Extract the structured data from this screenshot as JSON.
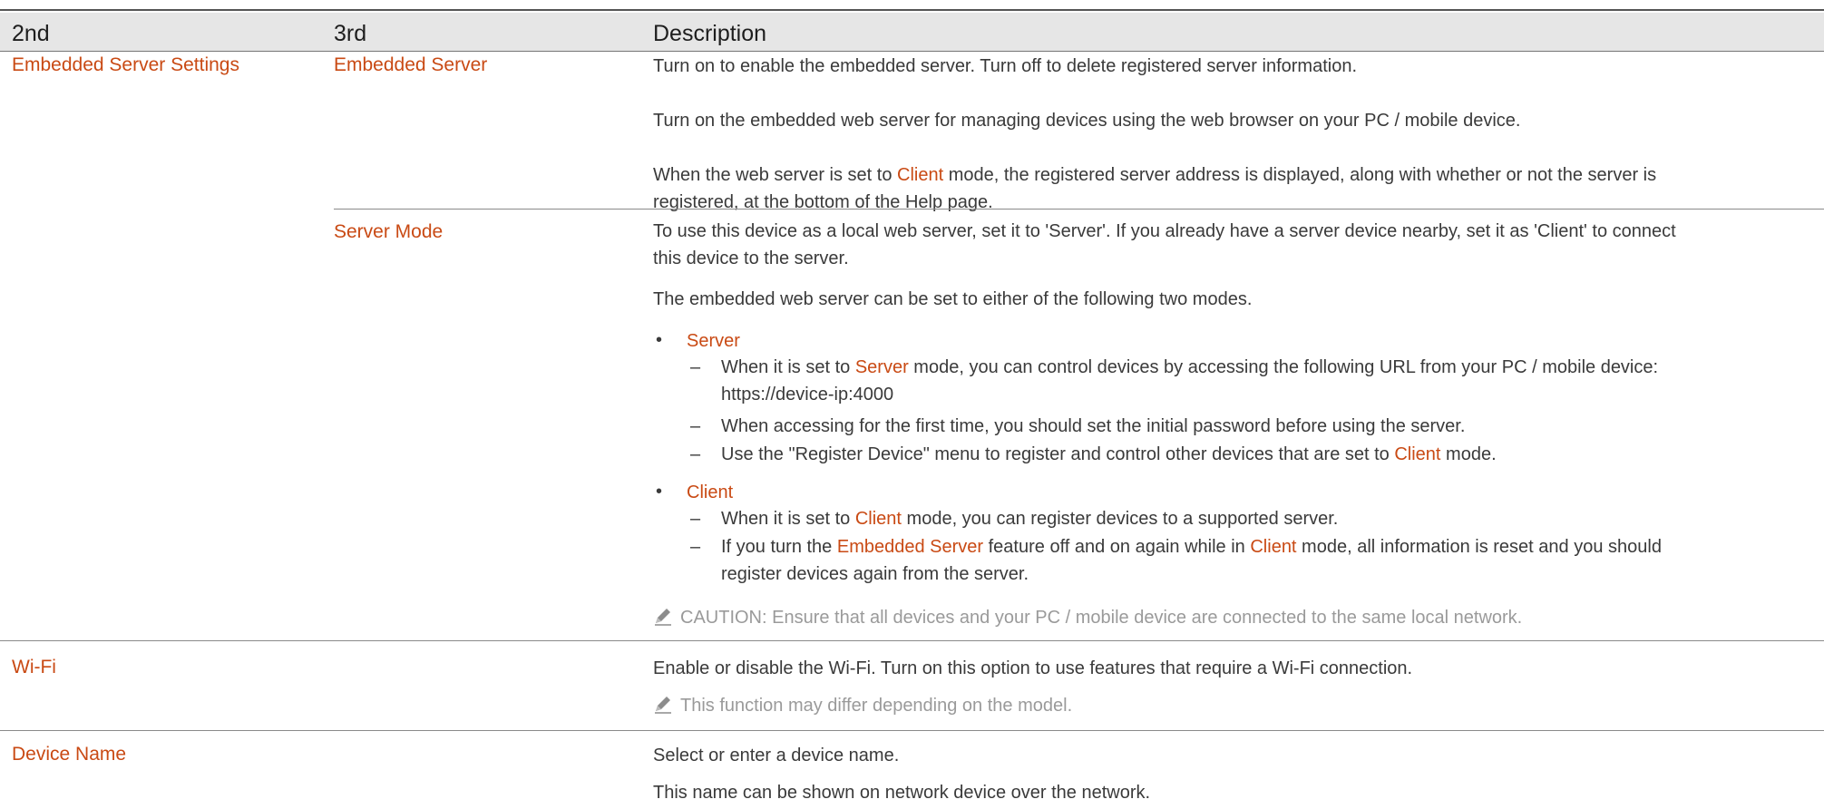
{
  "header": {
    "col_2nd": "2nd",
    "col_3rd": "3rd",
    "col_desc": "Description"
  },
  "rows": {
    "embedded_server_settings": {
      "label": "Embedded Server Settings",
      "embedded_server": {
        "label": "Embedded Server",
        "p1": "Turn on to enable the embedded server. Turn off to delete registered server information.",
        "p2": "Turn on the embedded web server for managing devices using the web browser on your PC / mobile device.",
        "p3_a": "When the web server is set to ",
        "p3_hl": "Client",
        "p3_b": " mode, the registered server address is displayed, along with whether or not the server is",
        "p3_c": "registered, at the bottom of the Help page."
      },
      "server_mode": {
        "label": "Server Mode",
        "p1_a": "To use this device as a local web server, set it to 'Server'. If you already have a server device nearby, set it as 'Client' to connect",
        "p1_b": "this device to the server.",
        "p2": "The embedded web server can be set to either of the following two modes.",
        "bullet_server": "Server",
        "server_d1_a": "When it is set to ",
        "server_d1_hl": "Server",
        "server_d1_b": " mode, you can control devices by accessing the following URL from your PC / mobile device:",
        "server_d1_c": "https://device-ip:4000",
        "server_d2": "When accessing for the first time, you should set the initial password before using the server.",
        "server_d3_a": "Use the \"Register Device\" menu to register and control other devices that are set to ",
        "server_d3_hl": "Client",
        "server_d3_b": " mode.",
        "bullet_client": "Client",
        "client_d1_a": "When it is set to ",
        "client_d1_hl": "Client",
        "client_d1_b": " mode, you can register devices to a supported server.",
        "client_d2_a": "If you turn the ",
        "client_d2_hl1": "Embedded Server",
        "client_d2_b": " feature off and on again while in ",
        "client_d2_hl2": "Client",
        "client_d2_c": " mode, all information is reset and you should",
        "client_d2_d": "register devices again from the server.",
        "note": "CAUTION: Ensure that all devices and your PC / mobile device are connected to the same local network."
      }
    },
    "wifi": {
      "label": "Wi-Fi",
      "p1": "Enable or disable the Wi-Fi. Turn on this option to use features that require a Wi-Fi connection.",
      "note": "This function may differ depending on the model."
    },
    "device_name": {
      "label": "Device Name",
      "p1": "Select or enter a device name.",
      "p2": "This name can be shown on network device over the network."
    }
  },
  "colors": {
    "highlight": "#c94a14",
    "header_bg": "#e6e6e6",
    "note_gray": "#9a9a9a"
  },
  "icons": {
    "note": "pencil-icon"
  }
}
